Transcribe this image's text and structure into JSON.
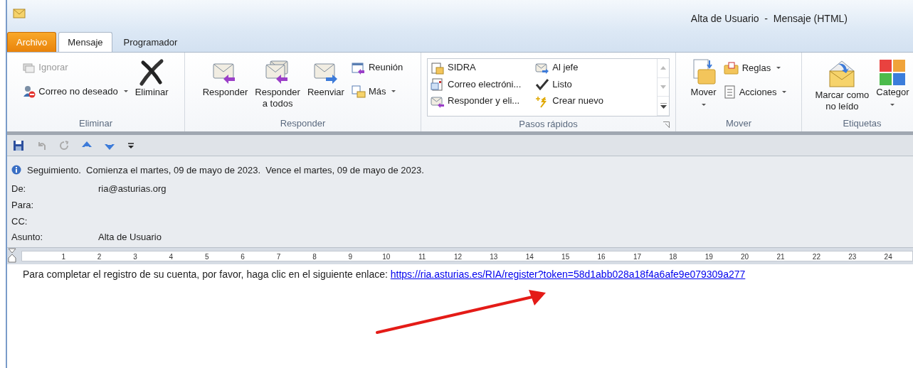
{
  "window": {
    "title": "Alta de Usuario  -  Mensaje (HTML)"
  },
  "tabs": [
    {
      "label": "Archivo",
      "kind": "file",
      "selected": false
    },
    {
      "label": "Mensaje",
      "kind": "tab",
      "selected": true
    },
    {
      "label": "Programador",
      "kind": "tab",
      "selected": false
    }
  ],
  "ribbon": {
    "groups": [
      {
        "label": "Eliminar",
        "columns": [
          [
            {
              "kind": "small",
              "label": "Ignorar",
              "disabled": true,
              "dropdown": false
            },
            {
              "kind": "small",
              "label": "Correo no deseado",
              "disabled": false,
              "dropdown": true
            }
          ],
          [
            {
              "kind": "large",
              "lines": [
                "Eliminar"
              ],
              "disabled": false,
              "dropdown": false
            }
          ]
        ]
      },
      {
        "label": "Responder",
        "columns": [
          [
            {
              "kind": "large",
              "lines": [
                "Responder"
              ],
              "disabled": false,
              "dropdown": false
            }
          ],
          [
            {
              "kind": "large",
              "lines": [
                "Responder",
                "a todos"
              ],
              "disabled": false,
              "dropdown": false
            }
          ],
          [
            {
              "kind": "large",
              "lines": [
                "Reenviar"
              ],
              "disabled": false,
              "dropdown": false
            }
          ],
          [
            {
              "kind": "small",
              "label": "Reunión",
              "disabled": false,
              "dropdown": false
            },
            {
              "kind": "small",
              "label": "Más",
              "disabled": false,
              "dropdown": true
            }
          ]
        ]
      },
      {
        "label": "Pasos rápidos",
        "launcher": true,
        "gallery": [
          [
            "SIDRA",
            "Correo electróni...",
            "Responder y eli..."
          ],
          [
            "Al jefe",
            "Listo",
            "Crear nuevo"
          ]
        ]
      },
      {
        "label": "Mover",
        "columns": [
          [
            {
              "kind": "large",
              "lines": [
                "Mover"
              ],
              "disabled": false,
              "dropdown": true
            }
          ],
          [
            {
              "kind": "small",
              "label": "Reglas",
              "disabled": false,
              "dropdown": true
            },
            {
              "kind": "small",
              "label": "Acciones",
              "disabled": false,
              "dropdown": true
            }
          ]
        ]
      },
      {
        "label": "Etiquetas",
        "columns": [
          [
            {
              "kind": "large",
              "lines": [
                "Marcar como",
                "no leído"
              ],
              "disabled": false,
              "dropdown": false
            }
          ],
          [
            {
              "kind": "large",
              "lines": [
                "Categor"
              ],
              "disabled": false,
              "dropdown": true
            }
          ]
        ]
      }
    ]
  },
  "info_bar": "Seguimiento.  Comienza el martes, 09 de mayo de 2023.  Vence el martes, 09 de mayo de 2023.",
  "fields": [
    {
      "label": "De:",
      "value": "ria@asturias.org"
    },
    {
      "label": "Para:"
    },
    {
      "label": "CC:"
    },
    {
      "label": "Asunto:",
      "value": "Alta de Usuario"
    }
  ],
  "ruler": [
    "1",
    "2",
    "3",
    "4",
    "5",
    "6",
    "7",
    "8",
    "9",
    "10",
    "11",
    "12",
    "13",
    "14",
    "15",
    "16",
    "17",
    "18",
    "19",
    "20",
    "21",
    "22",
    "23",
    "24"
  ],
  "body": {
    "text": "Para completar el registro de su cuenta, por favor, haga clic en el siguiente enlace: ",
    "link": "https://ria.asturias.es/RIA/register?token=58d1abb028a18f4a6afe9e079309a277"
  }
}
